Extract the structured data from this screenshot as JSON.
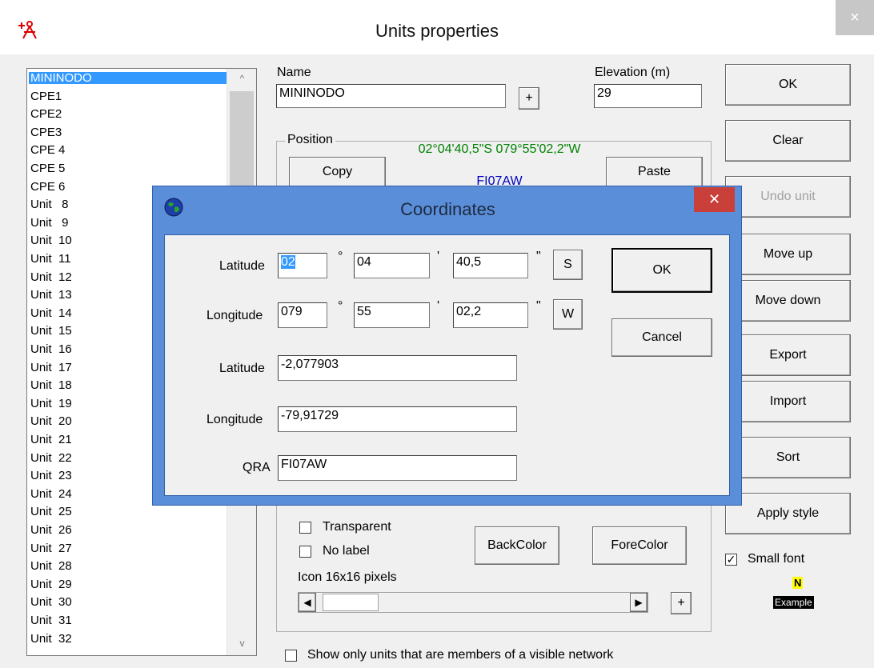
{
  "window": {
    "title": "Units properties",
    "close_glyph": "×",
    "app_icon": "compass-red-icon"
  },
  "units_list": {
    "items": [
      "MININODO",
      "CPE1",
      "CPE2",
      "CPE3",
      "CPE 4",
      "CPE 5",
      "CPE 6",
      "Unit   8",
      "Unit   9",
      "Unit  10",
      "Unit  11",
      "Unit  12",
      "Unit  13",
      "Unit  14",
      "Unit  15",
      "Unit  16",
      "Unit  17",
      "Unit  18",
      "Unit  19",
      "Unit  20",
      "Unit  21",
      "Unit  22",
      "Unit  23",
      "Unit  24",
      "Unit  25",
      "Unit  26",
      "Unit  27",
      "Unit  28",
      "Unit  29",
      "Unit  30",
      "Unit  31",
      "Unit  32"
    ],
    "selected_index": 0,
    "scroll_up": "^",
    "scroll_down": "v"
  },
  "name_field": {
    "label": "Name",
    "value": "MININODO",
    "plus": "+"
  },
  "elevation_field": {
    "label": "Elevation (m)",
    "value": "29"
  },
  "position": {
    "group_label": "Position",
    "coords_text": "02°04'40,5\"S 079°55'02,2\"W",
    "qra_text": "FI07AW",
    "copy_label": "Copy",
    "paste_label": "Paste"
  },
  "style_area": {
    "transparent_label": "Transparent",
    "no_label_label": "No label",
    "backcolor_label": "BackColor",
    "forecolor_label": "ForeColor",
    "icon_size_label": "Icon 16x16 pixels",
    "scroll_left": "◀",
    "scroll_right": "▶",
    "plus": "+"
  },
  "show_only_label": "Show only units that are members of a visible network",
  "side_buttons": {
    "ok": "OK",
    "clear": "Clear",
    "undo_unit": "Undo unit",
    "move_up": "Move up",
    "move_down": "Move down",
    "export": "Export",
    "import": "Import",
    "sort": "Sort",
    "apply_style": "Apply style"
  },
  "small_font": {
    "label": "Small font",
    "checked": "✓",
    "example_n": "N",
    "example_text": "Example"
  },
  "coordinates_dialog": {
    "title": "Coordinates",
    "close_glyph": "✕",
    "icon": "globe-icon",
    "lat_label": "Latitude",
    "lat_deg": "02",
    "lat_min": "04",
    "lat_sec": "40,5",
    "lat_hem": "S",
    "lon_label": "Longitude",
    "lon_deg": "079",
    "lon_min": "55",
    "lon_sec": "02,2",
    "lon_hem": "W",
    "deg_sym": "°",
    "min_sym": "'",
    "sec_sym": "\"",
    "lat_dec_label": "Latitude",
    "lat_dec": "-2,077903",
    "lon_dec_label": "Longitude",
    "lon_dec": "-79,91729",
    "qra_label": "QRA",
    "qra": "FI07AW",
    "ok": "OK",
    "cancel": "Cancel"
  }
}
